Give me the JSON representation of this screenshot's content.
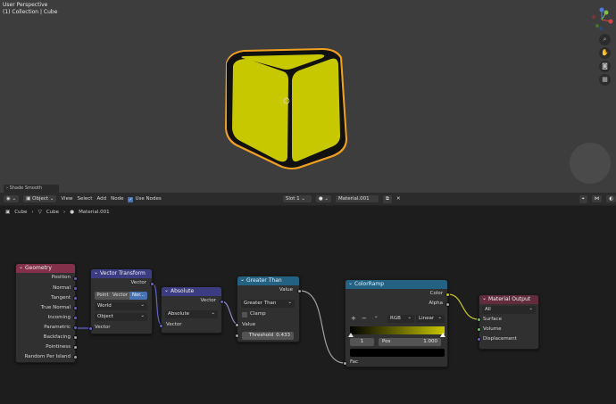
{
  "viewport": {
    "mode_label": "User Perspective",
    "collection_label": "(1) Collection | Cube",
    "last_operator": "Shade Smooth",
    "gizmo": {
      "x_label": "X",
      "y_label": "Y",
      "z_label": "Z"
    },
    "icons": [
      "zoom-icon",
      "hand-pan-icon",
      "camera-icon",
      "grid-icon"
    ],
    "object_color": "#c8c800",
    "outline_color": "#f0a020"
  },
  "node_header": {
    "editor_type_icon": "node-editor-icon",
    "object_mode": "Object",
    "menus": [
      "View",
      "Select",
      "Add",
      "Node"
    ],
    "use_nodes_label": "Use Nodes",
    "slot": "Slot 1",
    "material": "Material.001"
  },
  "breadcrumb": {
    "items": [
      "Cube",
      "Cube",
      "Material.001"
    ]
  },
  "nodes": {
    "geometry": {
      "title": "Geometry",
      "outputs": [
        "Position",
        "Normal",
        "Tangent",
        "True Normal",
        "Incoming",
        "Parametric",
        "Backfacing",
        "Pointiness",
        "Random Per Island"
      ]
    },
    "vector_transform": {
      "title": "Vector Transform",
      "output": "Vector",
      "type_options": [
        "Point",
        "Vector",
        "Nor..."
      ],
      "type_selected": "Nor...",
      "convert_from": "World",
      "convert_to": "Object",
      "input": "Vector"
    },
    "absolute": {
      "title": "Absolute",
      "output": "Vector",
      "operation": "Absolute",
      "input": "Vector"
    },
    "greater_than": {
      "title": "Greater Than",
      "output": "Value",
      "operation": "Greater Than",
      "clamp_label": "Clamp",
      "clamp_checked": false,
      "input": "Value",
      "threshold_label": "Threshold",
      "threshold_value": "0.433"
    },
    "colorramp": {
      "title": "ColorRamp",
      "outputs": [
        "Color",
        "Alpha"
      ],
      "add": "+",
      "remove": "−",
      "color_mode": "RGB",
      "interpolation": "Linear",
      "stop_index": "1",
      "pos_label": "Pos",
      "pos_value": "1.000",
      "input": "Fac",
      "ramp_from": "#000000",
      "ramp_to": "#c8c800"
    },
    "material_output": {
      "title": "Material Output",
      "target": "All",
      "inputs": [
        "Surface",
        "Volume",
        "Displacement"
      ]
    }
  }
}
